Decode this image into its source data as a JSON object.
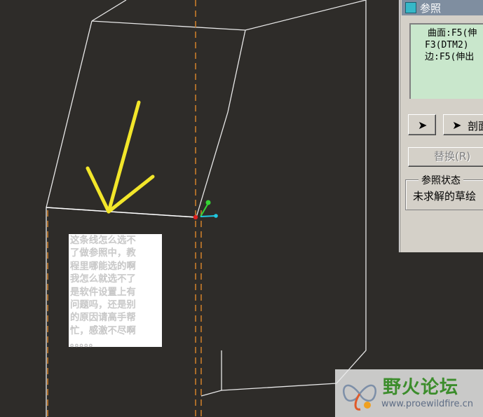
{
  "viewport": {
    "background": "#2e2c29",
    "edge_color": "#e8e8e8",
    "datum_color": "#c87d2a",
    "arrow_color": "#f2e62a"
  },
  "ref_dialog": {
    "title": "参照",
    "references": [
      "曲面:F5(伸",
      "F3(DTM2)",
      "边:F5(伸出"
    ],
    "select_icon": "cursor-arrow-icon",
    "section_button": "剖面",
    "replace_button": "替换(R)",
    "status_group_label": "参照状态",
    "status_text": "未求解的草绘"
  },
  "question_lines": [
    "这条线怎么选不",
    "了做参照中，教",
    "程里哪能选的啊",
    "我怎么就选不了",
    "是软件设置上有",
    "问题吗，还是别",
    "的原因请高手帮",
    "忙，感激不尽啊",
    "。。。。。"
  ],
  "watermark": {
    "name": "野火论坛",
    "url": "www.proewildfire.cn",
    "icon": "butterfly-logo-icon"
  }
}
